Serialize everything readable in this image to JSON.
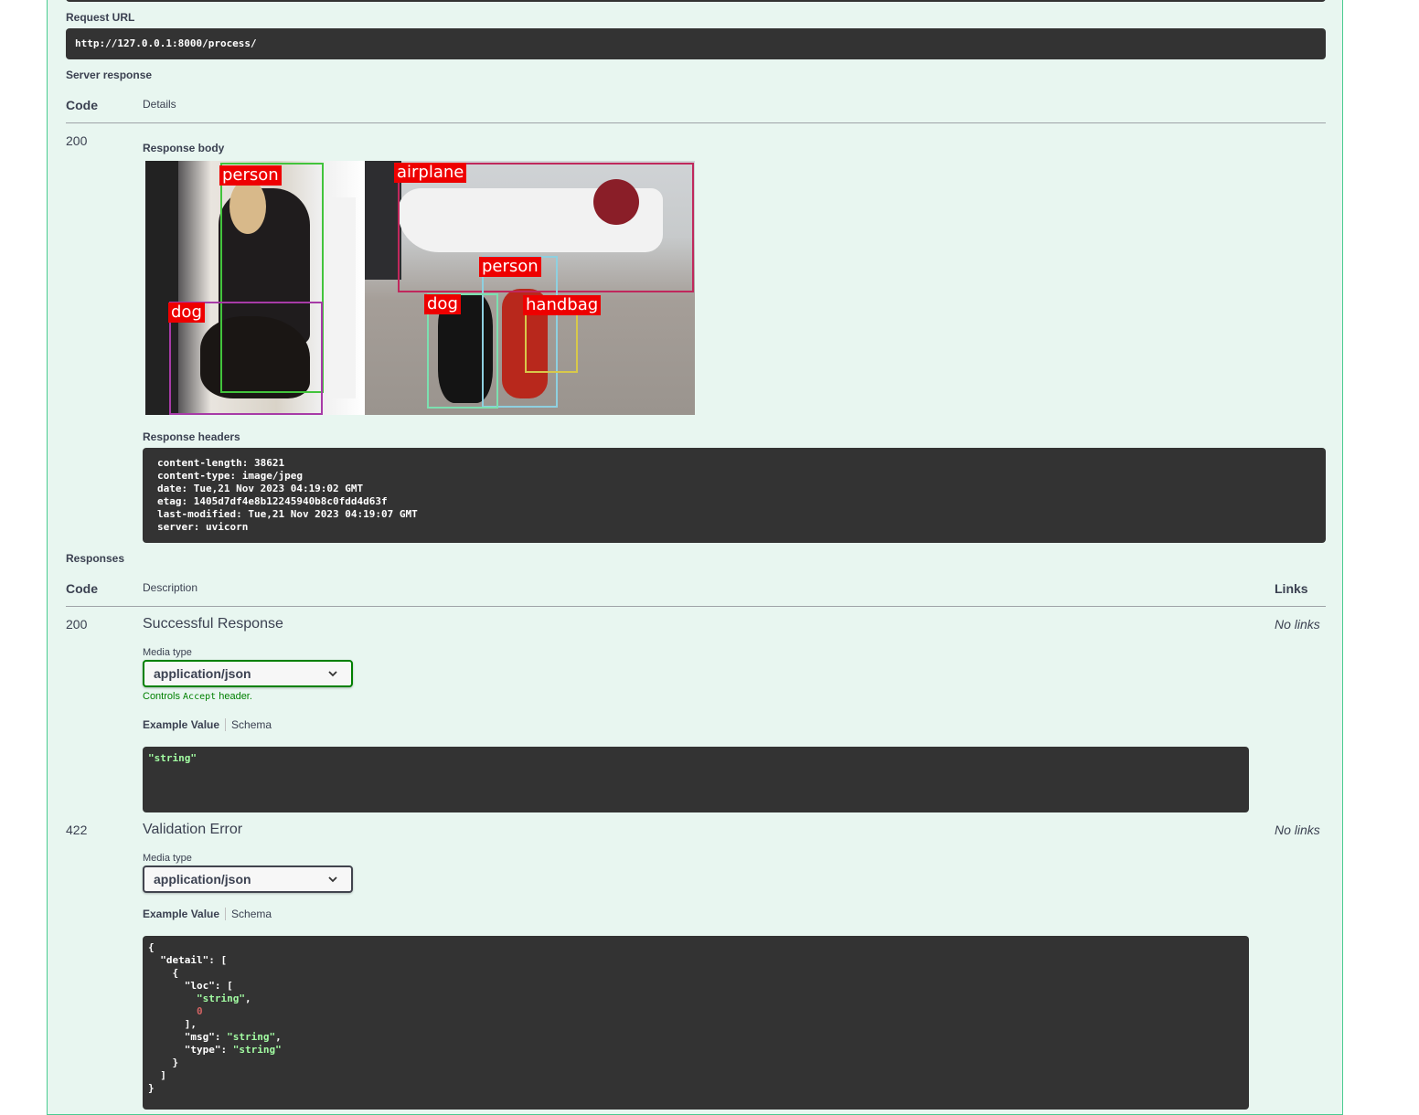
{
  "request_url": {
    "label": "Request URL",
    "value": "http://127.0.0.1:8000/process/"
  },
  "server_response": {
    "label": "Server response",
    "col_code": "Code",
    "col_details": "Details",
    "status_code": "200",
    "body_label": "Response body",
    "detections": [
      "person",
      "dog",
      "airplane",
      "person",
      "dog",
      "handbag"
    ],
    "headers_label": "Response headers",
    "headers": [
      "content-length: 38621",
      "content-type: image/jpeg",
      "date: Tue,21 Nov 2023 04:19:02 GMT",
      "etag: 1405d7df4e8b12245940b8c0fdd4d63f",
      "last-modified: Tue,21 Nov 2023 04:19:07 GMT",
      "server: uvicorn"
    ]
  },
  "responses": {
    "label": "Responses",
    "col_code": "Code",
    "col_description": "Description",
    "col_links": "Links",
    "items": [
      {
        "code": "200",
        "description": "Successful Response",
        "links": "No links",
        "media_type_label": "Media type",
        "media_type": "application/json",
        "controls_prefix": "Controls",
        "controls_code": "Accept",
        "controls_suffix": "header.",
        "tab_example": "Example Value",
        "tab_schema": "Schema",
        "example": "\"string\""
      },
      {
        "code": "422",
        "description": "Validation Error",
        "links": "No links",
        "media_type_label": "Media type",
        "media_type": "application/json",
        "tab_example": "Example Value",
        "tab_schema": "Schema",
        "example_lines": {
          "l1": "{",
          "l2_key": "  \"detail\": [",
          "l3": "    {",
          "l4": "      \"loc\": [",
          "l5": "\"string\"",
          "l6": "0",
          "l7": "      ],",
          "l8_key": "      \"msg\": ",
          "l8_val": "\"string\"",
          "l9_key": "      \"type\": ",
          "l9_val": "\"string\"",
          "l10": "    }",
          "l11": "  ]",
          "l12": "}"
        }
      }
    ]
  }
}
